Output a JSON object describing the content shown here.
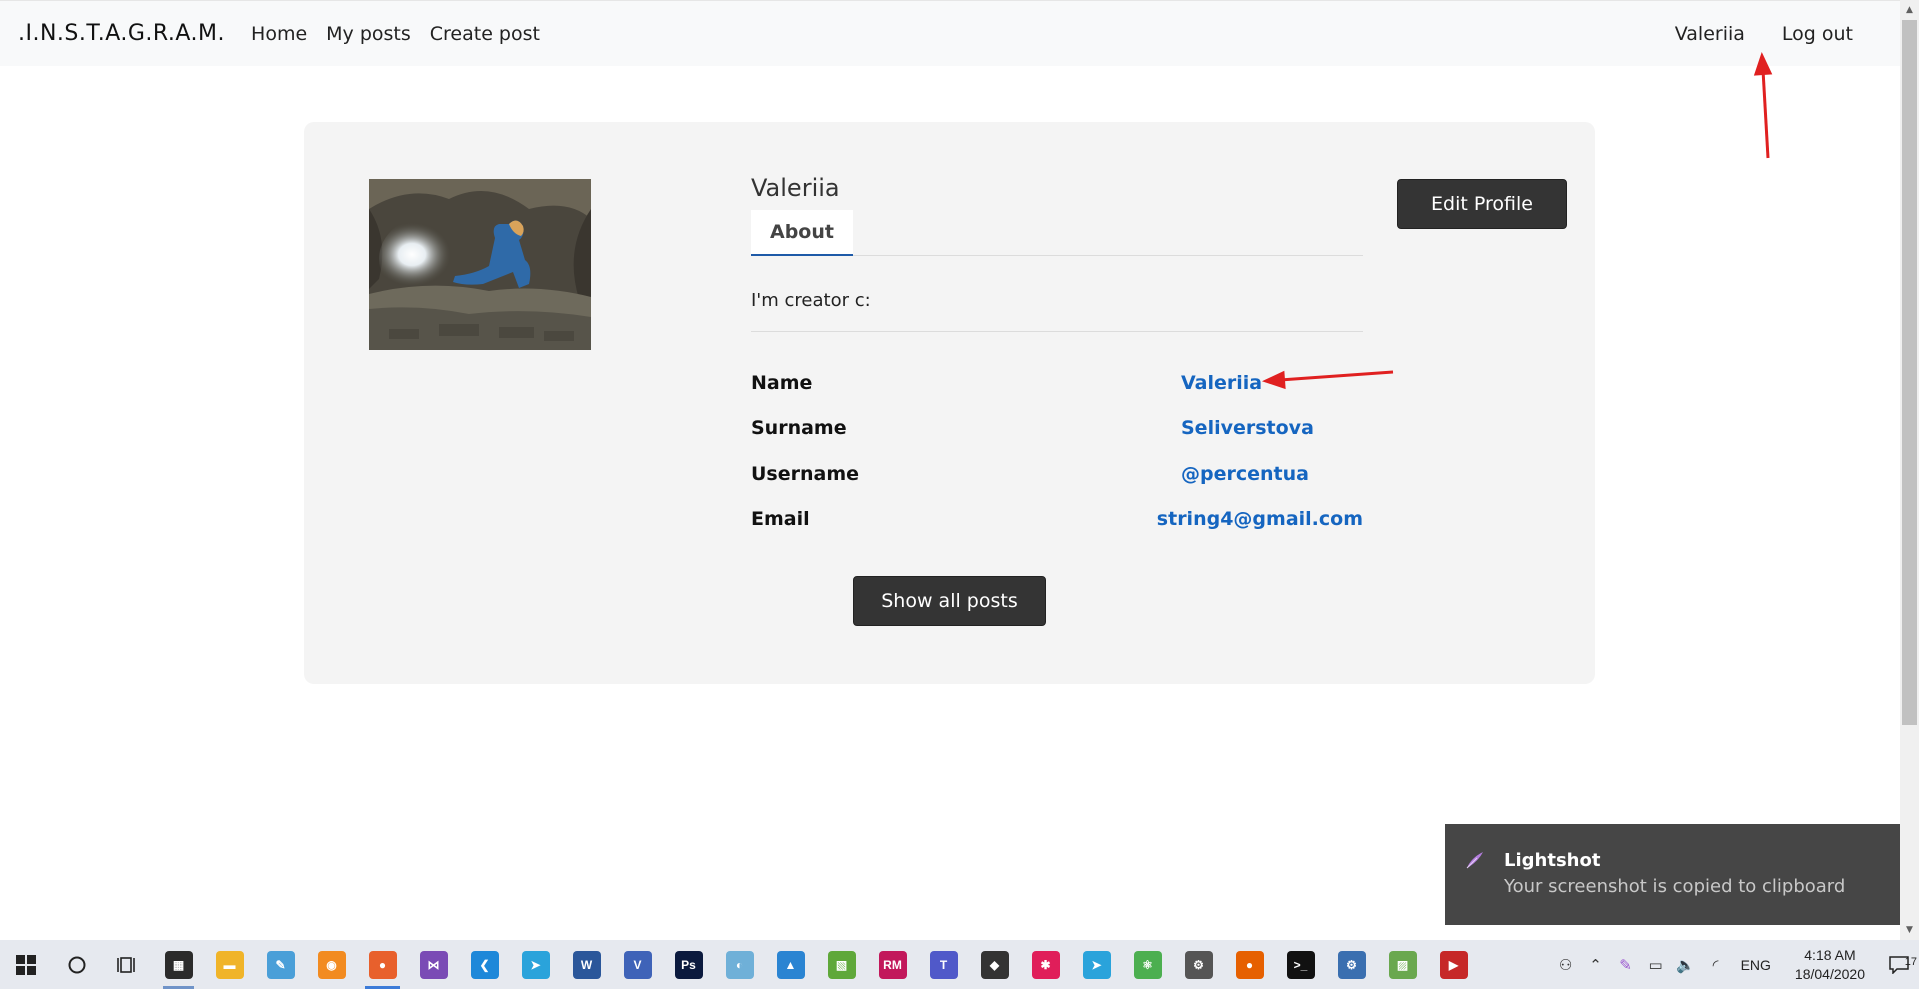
{
  "navbar": {
    "brand": ".I.N.S.T.A.G.R.A.M.",
    "links": [
      {
        "label": "Home"
      },
      {
        "label": "My posts"
      },
      {
        "label": "Create post"
      }
    ],
    "user": "Valeriia",
    "logout": "Log out"
  },
  "profile": {
    "display_name": "Valeriia",
    "tab_about": "About",
    "bio": "I'm creator c:",
    "edit_label": "Edit Profile",
    "show_posts_label": "Show all posts",
    "fields": [
      {
        "label": "Name",
        "value": "Valeriia"
      },
      {
        "label": "Surname",
        "value": "Seliverstova"
      },
      {
        "label": "Username",
        "value": "@percentua"
      },
      {
        "label": "Email",
        "value": "string4@gmail.com"
      }
    ]
  },
  "toast": {
    "title": "Lightshot",
    "message": "Your screenshot is copied to clipboard"
  },
  "taskbar": {
    "language": "ENG",
    "time": "4:18 AM",
    "date": "18/04/2020",
    "notification_count": "17",
    "apps": [
      {
        "icon": "calculator-icon",
        "color": "#2b2b2b",
        "glyph": "▦"
      },
      {
        "icon": "file-explorer-icon",
        "color": "#f0b429",
        "glyph": "▬"
      },
      {
        "icon": "notes-icon",
        "color": "#4a9fd8",
        "glyph": "✎"
      },
      {
        "icon": "ucbrowser-icon",
        "color": "#f28b20",
        "glyph": "◉"
      },
      {
        "icon": "firefox-icon",
        "color": "#e8602c",
        "glyph": "●"
      },
      {
        "icon": "visual-studio-icon",
        "color": "#7a4bb5",
        "glyph": "⋈"
      },
      {
        "icon": "vscode-icon",
        "color": "#1e88d9",
        "glyph": "❮"
      },
      {
        "icon": "telegram-icon",
        "color": "#2aa3db",
        "glyph": "➤"
      },
      {
        "icon": "word-icon",
        "color": "#2b579a",
        "glyph": "W"
      },
      {
        "icon": "visual-studio-code-alt-icon",
        "color": "#3f63b8",
        "glyph": "V"
      },
      {
        "icon": "photoshop-icon",
        "color": "#0b1a3e",
        "glyph": "Ps"
      },
      {
        "icon": "paint-icon",
        "color": "#6fb0d8",
        "glyph": "◐"
      },
      {
        "icon": "sail-icon",
        "color": "#2a84d2",
        "glyph": "▲"
      },
      {
        "icon": "image-tool-icon",
        "color": "#5fa83a",
        "glyph": "▧"
      },
      {
        "icon": "rubymine-icon",
        "color": "#c2185b",
        "glyph": "RM"
      },
      {
        "icon": "teams-icon",
        "color": "#5059c9",
        "glyph": "T"
      },
      {
        "icon": "inkscape-icon",
        "color": "#333333",
        "glyph": "◆"
      },
      {
        "icon": "slack-icon",
        "color": "#e01e5a",
        "glyph": "✱"
      },
      {
        "icon": "telegram-alt-icon",
        "color": "#2aa3db",
        "glyph": "➤"
      },
      {
        "icon": "atom-icon",
        "color": "#4caf50",
        "glyph": "⚛"
      },
      {
        "icon": "settings-icon",
        "color": "#555555",
        "glyph": "⚙"
      },
      {
        "icon": "firefox-alt-icon",
        "color": "#e66000",
        "glyph": "●"
      },
      {
        "icon": "terminal-icon",
        "color": "#111111",
        "glyph": ">_"
      },
      {
        "icon": "gear-tool-icon",
        "color": "#3a6fb0",
        "glyph": "⚙"
      },
      {
        "icon": "image-editor-icon",
        "color": "#6aa84f",
        "glyph": "▨"
      },
      {
        "icon": "video-player-icon",
        "color": "#c62828",
        "glyph": "▶"
      }
    ]
  }
}
